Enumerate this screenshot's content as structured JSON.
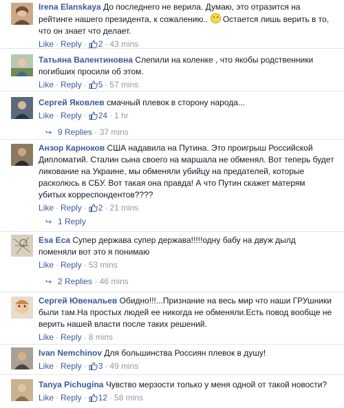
{
  "ui": {
    "like": "Like",
    "reply": "Reply",
    "sep": "·"
  },
  "comments": [
    {
      "author": "Irena Elanskaya",
      "text": "До последнего не верила. Думаю, это отразится на рейтинге нашего президента, к сожалению..",
      "text_after_emoji": "Остается лишь верить в то, что он знает что делает.",
      "likes": "2",
      "time": "43 mins"
    },
    {
      "author": "Татьяна Валентиновна",
      "text": "Слепили на коленке , что якобы родственники погибших просили об этом.",
      "likes": "5",
      "time": "57 mins"
    },
    {
      "author": "Сергей Яковлев",
      "text": "смачный плевок в сторону народа...",
      "likes": "24",
      "time": "1 hr",
      "replies": {
        "label": "9 Replies",
        "time": "37 mins"
      }
    },
    {
      "author": "Анзор Карноков",
      "text": "США надавила на Путина. Это проигрыш Российской Дипломатий. Сталин сына своего на маршала не обменял. Вот теперь будет ликование на Украине, мы обменяли убийцу на предателей, которые расколюсь в СБУ. Вот такая она правда! А что Путин скажет матерям убитых корреспондентов????",
      "likes": "2",
      "time": "21 mins",
      "replies": {
        "label": "1 Reply",
        "time": ""
      }
    },
    {
      "author": "Esa Eca",
      "text": "Супер держава супер держава!!!!!одну бабу на двуж дылд поменяли вот это я понимаю",
      "likes": "",
      "time": "53 mins",
      "replies": {
        "label": "2 Replies",
        "time": "46 mins"
      }
    },
    {
      "author": "Сергей Ювенальев",
      "text": "Обидно!!!...Признание на весь мир что наши ГРУшники были там.На простых людей ее никогда не обменяли.Есть повод вообще не верить нашей власти после таких решений.",
      "likes": "",
      "time": "8 mins"
    },
    {
      "author": "Ivan Nemchinov",
      "text": "Для большинства Россиян плевок в душу!",
      "likes": "3",
      "time": "49 mins"
    },
    {
      "author": "Tanya Pichugina",
      "text": "Чувство мерзости только у меня одной от такой новости?",
      "likes": "12",
      "time": "58 mins"
    }
  ],
  "colors": {
    "link": "#3b5998",
    "meta": "#9197a3",
    "text": "#141823",
    "divider": "#e5e6e9"
  }
}
